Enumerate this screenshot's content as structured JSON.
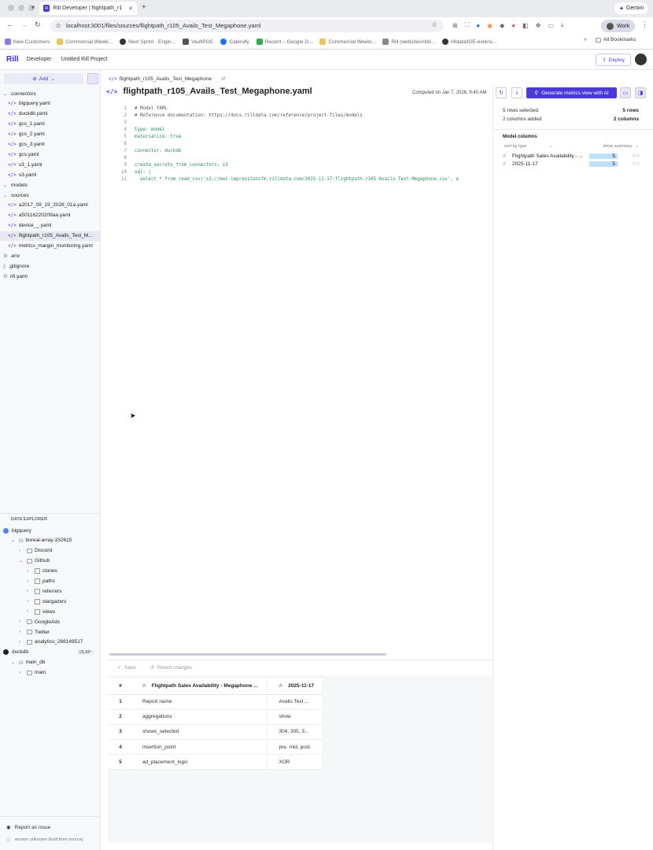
{
  "browser": {
    "tab_title": "Rill Developer | flightpath_r1",
    "url": "localhost:3001/files/sources/flightpath_r105_Avails_Test_Megaphone.yaml",
    "profile": "Work",
    "gemini": "Gemini",
    "bookmarks": [
      "New Customers",
      "Commercial Weekl...",
      "Next Sprint · Engin...",
      "VaultPOC",
      "Calendly",
      "Recent – Google D...",
      "Commercial Weekl...",
      "Rill (websites/rilld...",
      "rilldata/IDE-extens..."
    ],
    "all_bookmarks": "All Bookmarks"
  },
  "header": {
    "logo": "Rill",
    "crumbs": [
      "Developer",
      "Untitled Rill Project"
    ],
    "deploy": "Deploy"
  },
  "sidebar": {
    "add": "Add",
    "tree": [
      {
        "label": "connectors",
        "kind": "folder"
      },
      {
        "label": "bigquery.yaml",
        "kind": "file"
      },
      {
        "label": "duckdb.yaml",
        "kind": "file"
      },
      {
        "label": "gcs_1.yaml",
        "kind": "file"
      },
      {
        "label": "gcs_2.yaml",
        "kind": "file"
      },
      {
        "label": "gcs_3.yaml",
        "kind": "file"
      },
      {
        "label": "gcs.yaml",
        "kind": "file"
      },
      {
        "label": "s3_1.yaml",
        "kind": "file"
      },
      {
        "label": "s3.yaml",
        "kind": "file"
      },
      {
        "label": "models",
        "kind": "folder"
      },
      {
        "label": "sources",
        "kind": "folder"
      },
      {
        "label": "a2017_09_19_2026_01a.yaml",
        "kind": "file"
      },
      {
        "label": "a50116220209aa.yaml",
        "kind": "file"
      },
      {
        "label": "device__.yaml",
        "kind": "file"
      },
      {
        "label": "flightpath_r105_Avails_Test_M...",
        "kind": "file",
        "selected": true
      },
      {
        "label": "metrics_margin_monitoring.yaml",
        "kind": "file"
      },
      {
        "label": ".env",
        "kind": "gear"
      },
      {
        "label": ".gitignore",
        "kind": "plain"
      },
      {
        "label": "rill.yaml",
        "kind": "gear"
      }
    ],
    "explorer_title": "DATA EXPLORER",
    "explorer": [
      {
        "label": "bigquery",
        "depth": 0,
        "kind": "conn"
      },
      {
        "label": "boreal-array-332615",
        "depth": 1,
        "kind": "db"
      },
      {
        "label": "Discord",
        "depth": 2,
        "kind": "folder"
      },
      {
        "label": "Github",
        "depth": 2,
        "kind": "folder",
        "open": true
      },
      {
        "label": "clones",
        "depth": 3,
        "kind": "table"
      },
      {
        "label": "paths",
        "depth": 3,
        "kind": "table"
      },
      {
        "label": "referrers",
        "depth": 3,
        "kind": "table"
      },
      {
        "label": "stargazers",
        "depth": 3,
        "kind": "table"
      },
      {
        "label": "views",
        "depth": 3,
        "kind": "table"
      },
      {
        "label": "GoogleAds",
        "depth": 2,
        "kind": "folder"
      },
      {
        "label": "Twitter",
        "depth": 2,
        "kind": "folder"
      },
      {
        "label": "analytics_288149517",
        "depth": 2,
        "kind": "folder"
      },
      {
        "label": "duckdb",
        "depth": 0,
        "kind": "conn",
        "badge": "OLAP"
      },
      {
        "label": "main_db",
        "depth": 1,
        "kind": "db"
      },
      {
        "label": "main",
        "depth": 2,
        "kind": "folder"
      }
    ],
    "report_issue": "Report an issue",
    "version": "version unknown (built from source)"
  },
  "editor": {
    "breadcrumb": "flightpath_r105_Avails_Test_Megaphone",
    "title": "flightpath_r105_Avails_Test_Megaphone.yaml",
    "computed": "Computed on Jan 7, 2026, 9:40 AM",
    "generate": "Generate metrics view with AI",
    "lines": [
      "# Model YAML",
      "# Reference documentation: https://docs.rilldata.com/reference/project-files/models",
      "",
      "type: model",
      "materialize: true",
      "",
      "connector: duckdb",
      "",
      "create_secrets_from_connectors: s3",
      "sql: |",
      "  select * from read_csv('s3://moi-impressionsfm.rilldata.com/2025-11-17-flightpath-r105-Avails-Test-Megaphone.csv', a"
    ],
    "save": "Save",
    "revert": "Revert changes"
  },
  "results": {
    "columns": [
      "#",
      "Flightpath Sales Availability - Megaphone ...",
      "2025-11-17"
    ],
    "rows": [
      [
        "1",
        "Report name",
        "Avails Test ..."
      ],
      [
        "2",
        "aggregations",
        "show"
      ],
      [
        "3",
        "shows_selected",
        "304, 305, 3..."
      ],
      [
        "4",
        "insertion_point",
        "pre, mid, post"
      ],
      [
        "5",
        "ad_placement_logic",
        "XOR"
      ]
    ]
  },
  "panel": {
    "rows_selected": "5 rows selected",
    "rows_count": "5 rows",
    "cols_added": "2 columns added",
    "cols_count": "2 columns",
    "model_columns": "Model columns",
    "sort": "sort by type",
    "summary": "show summary",
    "columns": [
      {
        "type": "A",
        "name": "Flightpath Sales Availability - ...",
        "count": "5",
        "pct": "0%"
      },
      {
        "type": "A",
        "name": "2025-11-17",
        "count": "5",
        "pct": "0%"
      }
    ]
  }
}
